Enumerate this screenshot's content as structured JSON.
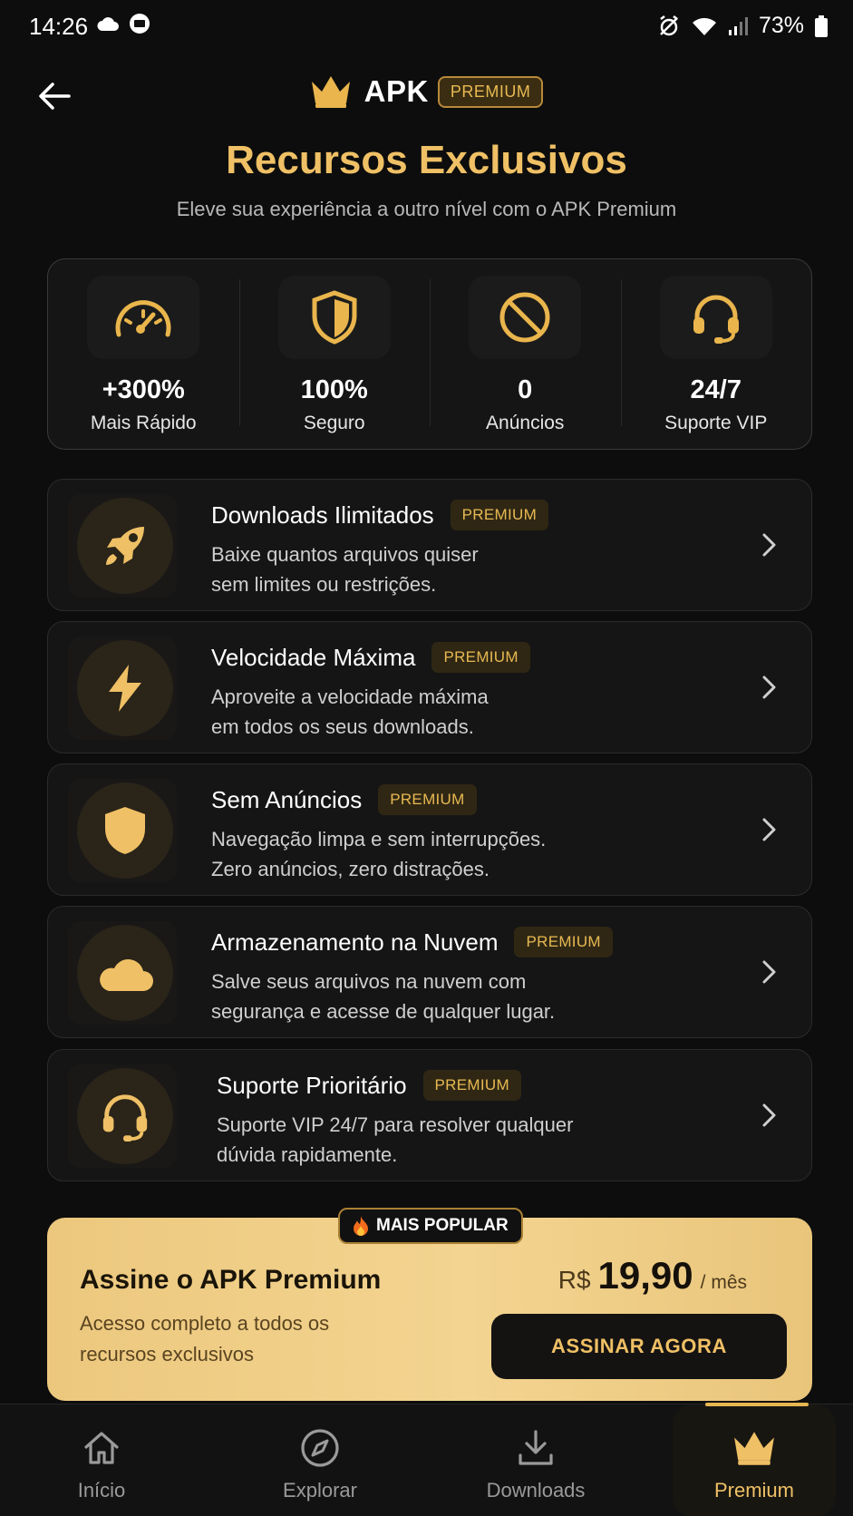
{
  "status_bar": {
    "time": "14:26",
    "battery": "73%",
    "icons_left": [
      "cloud-icon",
      "nfc-app-icon"
    ],
    "icons_right": [
      "alarm-off-icon",
      "wifi-icon",
      "signal-icon",
      "battery-icon"
    ]
  },
  "header": {
    "back_icon": "arrow-left-icon",
    "brand_icon": "crown-icon",
    "brand_name": "APK",
    "brand_badge": "PREMIUM"
  },
  "hero": {
    "title": "Recursos Exclusivos",
    "subtitle": "Eleve sua experiência a outro nível com o APK Premium"
  },
  "stats": [
    {
      "icon": "speedometer-icon",
      "value": "+300%",
      "label": "Mais Rápido"
    },
    {
      "icon": "shield-icon",
      "value": "100%",
      "label": "Seguro"
    },
    {
      "icon": "block-icon",
      "value": "0",
      "label": "Anúncios"
    },
    {
      "icon": "headset-icon",
      "value": "24/7",
      "label": "Suporte VIP"
    }
  ],
  "features": [
    {
      "icon": "rocket-icon",
      "title": "Downloads Ilimitados",
      "badge": "PREMIUM",
      "description": "Baixe quantos arquivos quiser\nsem limites ou restrições."
    },
    {
      "icon": "lightning-icon",
      "title": "Velocidade Máxima",
      "badge": "PREMIUM",
      "description": "Aproveite a velocidade máxima\nem todos os seus downloads."
    },
    {
      "icon": "shield-icon",
      "title": "Sem Anúncios",
      "badge": "PREMIUM",
      "description": "Navegação limpa e sem interrupções.\nZero anúncios, zero distrações."
    },
    {
      "icon": "cloud-icon",
      "title": "Armazenamento na Nuvem",
      "badge": "PREMIUM",
      "description": "Salve seus arquivos na nuvem com\nsegurança e acesse de qualquer lugar."
    },
    {
      "icon": "headset-icon",
      "title": "Suporte Prioritário",
      "badge": "PREMIUM",
      "description": "Suporte VIP 24/7 para resolver qualquer\ndúvida rapidamente."
    }
  ],
  "cta": {
    "popular_badge": "MAIS POPULAR",
    "popular_icon": "fire-icon",
    "title": "Assine o APK Premium",
    "description": "Acesso completo a todos os\nrecursos exclusivos",
    "price_currency": "R$",
    "price_value": "19,90",
    "price_period": "/ mês",
    "button_label": "ASSINAR AGORA"
  },
  "bottom_nav": [
    {
      "icon": "home-icon",
      "label": "Início",
      "active": false
    },
    {
      "icon": "compass-icon",
      "label": "Explorar",
      "active": false
    },
    {
      "icon": "download-icon",
      "label": "Downloads",
      "active": false
    },
    {
      "icon": "crown-icon",
      "label": "Premium",
      "active": true
    }
  ],
  "colors": {
    "background": "#0d0d0d",
    "gold": "#efc065",
    "card": "#151515",
    "cta_gold": "#f0cf88"
  }
}
